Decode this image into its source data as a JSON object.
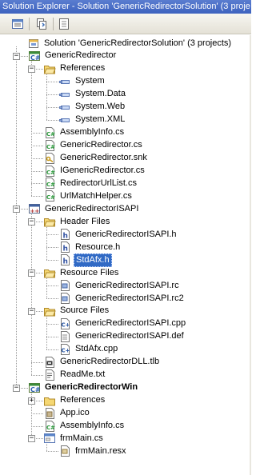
{
  "window": {
    "title": "Solution Explorer - Solution 'GenericRedirectorSolution' (3 proje"
  },
  "toolbar": {
    "buttons": [
      {
        "name": "properties-icon"
      },
      {
        "name": "show-all-files-icon"
      },
      {
        "name": "refresh-icon"
      }
    ]
  },
  "tree": {
    "items": [
      {
        "label": "Solution 'GenericRedirectorSolution' (3 projects)",
        "icon": "solution-icon",
        "level": 0,
        "expander": "none"
      },
      {
        "label": "GenericRedirector",
        "icon": "csharp-project-icon",
        "level": 1,
        "expander": "minus"
      },
      {
        "label": "References",
        "icon": "folder-open-icon",
        "level": 2,
        "expander": "minus"
      },
      {
        "label": "System",
        "icon": "reference-icon",
        "level": 3,
        "expander": "none"
      },
      {
        "label": "System.Data",
        "icon": "reference-icon",
        "level": 3,
        "expander": "none"
      },
      {
        "label": "System.Web",
        "icon": "reference-icon",
        "level": 3,
        "expander": "none"
      },
      {
        "label": "System.XML",
        "icon": "reference-icon",
        "level": 3,
        "expander": "none"
      },
      {
        "label": "AssemblyInfo.cs",
        "icon": "csharp-file-icon",
        "level": 2,
        "expander": "none"
      },
      {
        "label": "GenericRedirector.cs",
        "icon": "csharp-file-icon",
        "level": 2,
        "expander": "none"
      },
      {
        "label": "GenericRedirector.snk",
        "icon": "key-file-icon",
        "level": 2,
        "expander": "none"
      },
      {
        "label": "IGenericRedirector.cs",
        "icon": "csharp-file-icon",
        "level": 2,
        "expander": "none"
      },
      {
        "label": "RedirectorUrlList.cs",
        "icon": "csharp-file-icon",
        "level": 2,
        "expander": "none"
      },
      {
        "label": "UrlMatchHelper.cs",
        "icon": "csharp-file-icon",
        "level": 2,
        "expander": "none"
      },
      {
        "label": "GenericRedirectorISAPI",
        "icon": "cpp-project-icon",
        "level": 1,
        "expander": "minus"
      },
      {
        "label": "Header Files",
        "icon": "folder-open-icon",
        "level": 2,
        "expander": "minus"
      },
      {
        "label": "GenericRedirectorISAPI.h",
        "icon": "header-file-icon",
        "level": 3,
        "expander": "none"
      },
      {
        "label": "Resource.h",
        "icon": "header-file-icon",
        "level": 3,
        "expander": "none"
      },
      {
        "label": "StdAfx.h",
        "icon": "header-file-icon",
        "level": 3,
        "expander": "none",
        "selected": true
      },
      {
        "label": "Resource Files",
        "icon": "folder-open-icon",
        "level": 2,
        "expander": "minus"
      },
      {
        "label": "GenericRedirectorISAPI.rc",
        "icon": "resource-file-icon",
        "level": 3,
        "expander": "none"
      },
      {
        "label": "GenericRedirectorISAPI.rc2",
        "icon": "resource-file-icon",
        "level": 3,
        "expander": "none"
      },
      {
        "label": "Source Files",
        "icon": "folder-open-icon",
        "level": 2,
        "expander": "minus"
      },
      {
        "label": "GenericRedirectorISAPI.cpp",
        "icon": "cpp-file-icon",
        "level": 3,
        "expander": "none"
      },
      {
        "label": "GenericRedirectorISAPI.def",
        "icon": "def-file-icon",
        "level": 3,
        "expander": "none"
      },
      {
        "label": "StdAfx.cpp",
        "icon": "cpp-file-icon",
        "level": 3,
        "expander": "none"
      },
      {
        "label": "GenericRedirectorDLL.tlb",
        "icon": "tlb-file-icon",
        "level": 2,
        "expander": "none"
      },
      {
        "label": "ReadMe.txt",
        "icon": "text-file-icon",
        "level": 2,
        "expander": "none"
      },
      {
        "label": "GenericRedirectorWin",
        "icon": "csharp-project-icon",
        "level": 1,
        "expander": "minus",
        "bold": true
      },
      {
        "label": "References",
        "icon": "folder-closed-icon",
        "level": 2,
        "expander": "plus"
      },
      {
        "label": "App.ico",
        "icon": "ico-file-icon",
        "level": 2,
        "expander": "none"
      },
      {
        "label": "AssemblyInfo.cs",
        "icon": "csharp-file-icon",
        "level": 2,
        "expander": "none"
      },
      {
        "label": "frmMain.cs",
        "icon": "form-file-icon",
        "level": 2,
        "expander": "minus"
      },
      {
        "label": "frmMain.resx",
        "icon": "resx-file-icon",
        "level": 3,
        "expander": "none"
      }
    ]
  }
}
